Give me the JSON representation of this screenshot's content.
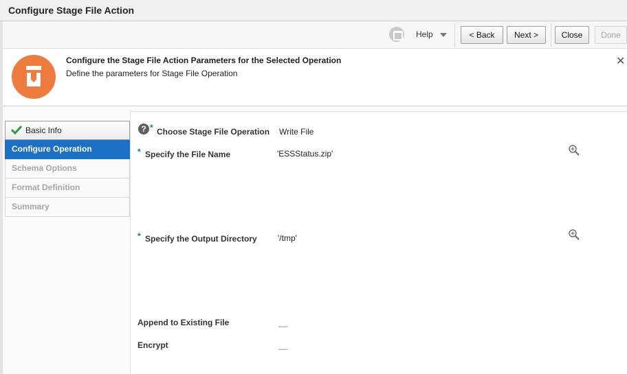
{
  "window": {
    "title": "Configure Stage File Action"
  },
  "toolbar": {
    "help_label": "Help",
    "back_label": "< Back",
    "next_label": "Next >",
    "close_label": "Close",
    "done_label": "Done"
  },
  "header": {
    "title": "Configure the Stage File Action Parameters for the Selected Operation",
    "subtitle": "Define the parameters for Stage File Operation",
    "close_glyph": "✕",
    "icon": "stage-file-icon",
    "icon_color": "#ef7c3f"
  },
  "train": {
    "items": [
      {
        "label": "Basic Info",
        "state": "completed"
      },
      {
        "label": "Configure Operation",
        "state": "active"
      },
      {
        "label": "Schema Options",
        "state": "disabled"
      },
      {
        "label": "Format Definition",
        "state": "disabled"
      },
      {
        "label": "Summary",
        "state": "disabled"
      }
    ]
  },
  "form": {
    "required_marker": "*",
    "help_glyph": "?",
    "operation": {
      "label": "Choose Stage File Operation",
      "value": "Write File"
    },
    "file_name": {
      "label": "Specify the File Name",
      "value": "'ESSStatus.zip'"
    },
    "output_dir": {
      "label": "Specify the Output Directory",
      "value": "'/tmp'"
    },
    "append": {
      "label": "Append to Existing File",
      "value": "__"
    },
    "encrypt": {
      "label": "Encrypt",
      "value": "__"
    }
  },
  "colors": {
    "accent": "#1b70c5",
    "completed_check": "#2f9e3f"
  }
}
